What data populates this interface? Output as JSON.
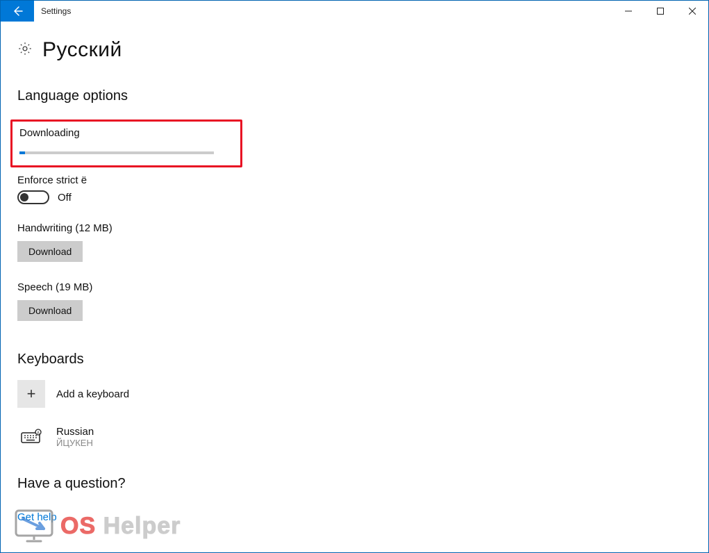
{
  "window": {
    "title": "Settings"
  },
  "page": {
    "heading": "Русский"
  },
  "language_options": {
    "section_title": "Language options",
    "downloading_label": "Downloading",
    "progress_percent": 3,
    "enforce_label": "Enforce strict ё",
    "toggle_state": "Off",
    "handwriting_label": "Handwriting (12 MB)",
    "handwriting_button": "Download",
    "speech_label": "Speech (19 MB)",
    "speech_button": "Download"
  },
  "keyboards": {
    "section_title": "Keyboards",
    "add_label": "Add a keyboard",
    "items": [
      {
        "name": "Russian",
        "layout": "ЙЦУКЕН"
      }
    ]
  },
  "help": {
    "section_title": "Have a question?",
    "link": "Get help"
  },
  "watermark": {
    "os": "OS",
    "helper": "Helper"
  },
  "colors": {
    "accent": "#0078D7",
    "highlight": "#E81123"
  }
}
